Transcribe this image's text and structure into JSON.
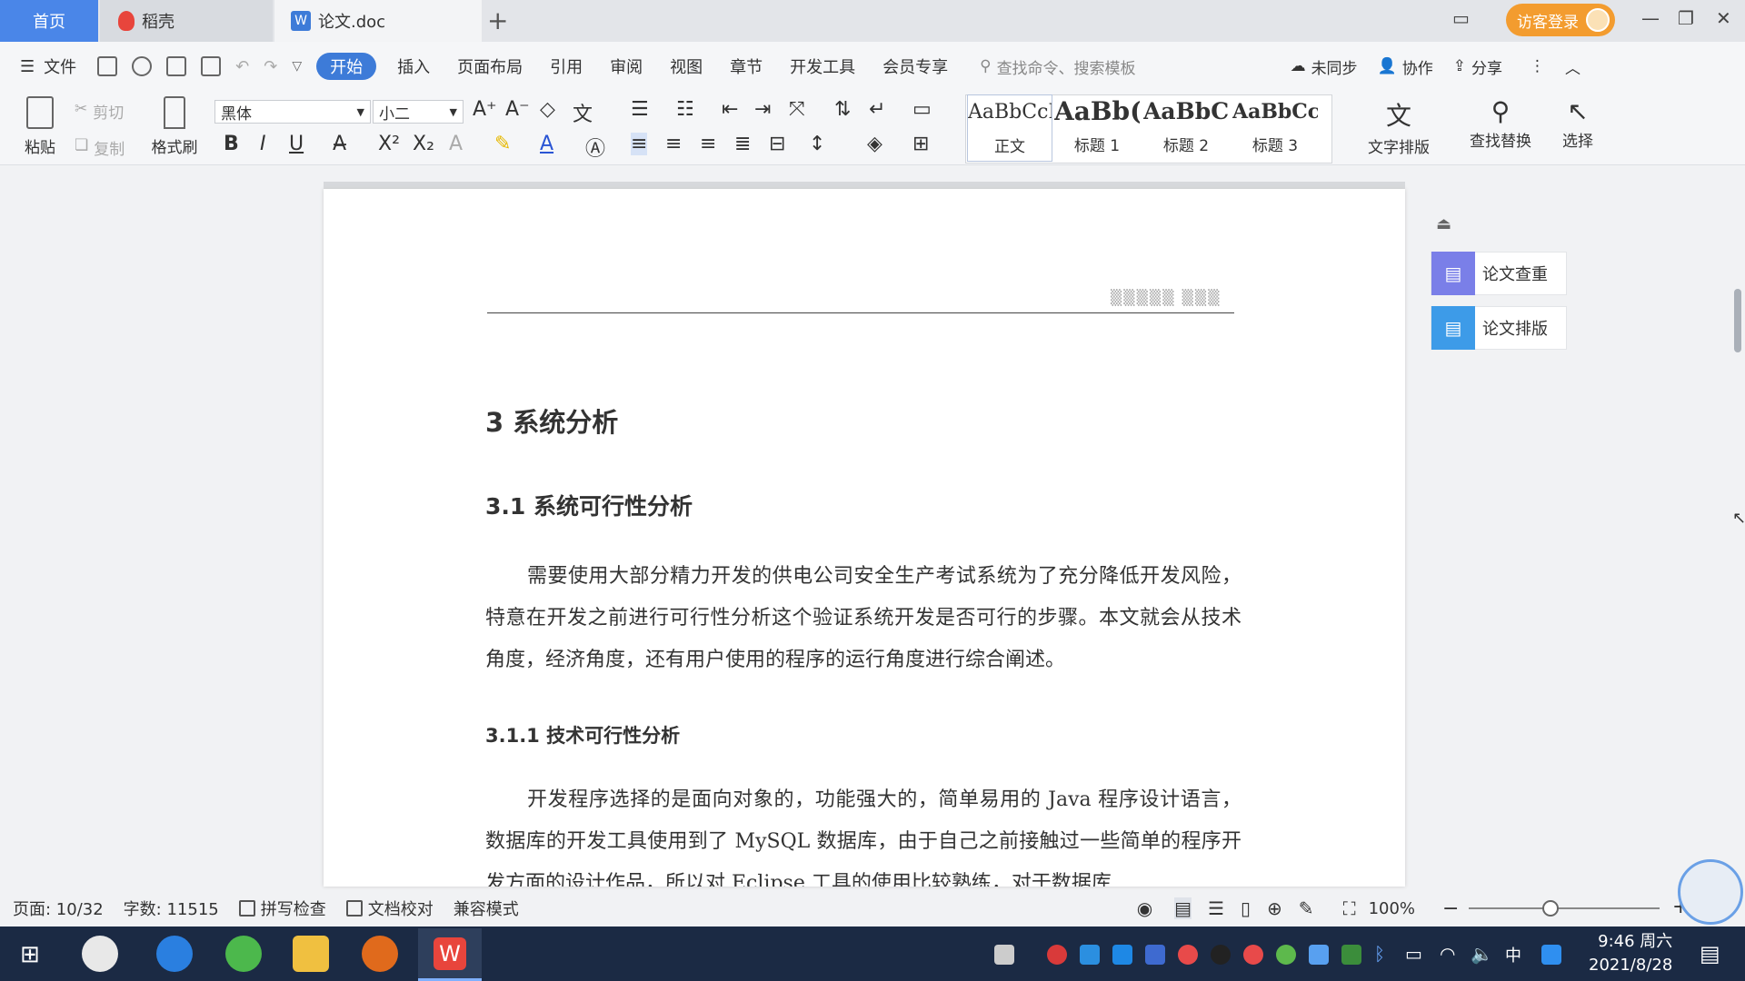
{
  "tabs": {
    "home": "首页",
    "daoke": "稻壳",
    "doc": "论文.doc",
    "new": "+"
  },
  "titlebar": {
    "login": "访客登录"
  },
  "menu": {
    "file": "文件",
    "items": [
      "开始",
      "插入",
      "页面布局",
      "引用",
      "审阅",
      "视图",
      "章节",
      "开发工具",
      "会员专享"
    ],
    "active": "开始",
    "search_placeholder": "查找命令、搜索模板",
    "sync": "未同步",
    "collab": "协作",
    "share": "分享"
  },
  "ribbon": {
    "paste": "粘贴",
    "cut": "剪切",
    "copy": "复制",
    "format_painter": "格式刷",
    "font": "黑体",
    "size": "小二",
    "styles": [
      {
        "sample": "AaBbCcI",
        "name": "正文"
      },
      {
        "sample": "AaBb(",
        "name": "标题 1"
      },
      {
        "sample": "AaBbC",
        "name": "标题 2"
      },
      {
        "sample": "AaBbCcl",
        "name": "标题 3"
      }
    ],
    "text_layout": "文字排版",
    "find_replace": "查找替换",
    "select": "选择"
  },
  "sidepanel": {
    "check": "论文查重",
    "layout": "论文排版"
  },
  "document": {
    "h1": "3  系统分析",
    "h2": "3.1 系统可行性分析",
    "p1": "需要使用大部分精力开发的供电公司安全生产考试系统为了充分降低开发风险，特意在开发之前进行可行性分析这个验证系统开发是否可行的步骤。本文就会从技术角度，经济角度，还有用户使用的程序的运行角度进行综合阐述。",
    "h3": "3.1.1  技术可行性分析",
    "p2": "开发程序选择的是面向对象的，功能强大的，简单易用的 Java 程序设计语言，数据库的开发工具使用到了 MySQL 数据库，由于自己之前接触过一些简单的程序开发方面的设计作品，所以对 Eclipse 工具的使用比较熟练，对于数据库"
  },
  "status": {
    "page": "页面: 10/32",
    "words": "字数: 11515",
    "spell": "拼写检查",
    "proof": "文档校对",
    "compat": "兼容模式",
    "zoom": "100%",
    "zoom_level": 0.43
  },
  "taskbar": {
    "time": "9:46 周六",
    "date": "2021/8/28",
    "ime": "中"
  },
  "colors": {
    "accent": "#3d7bd8",
    "login": "#f39c2f",
    "wps_red": "#e8453c",
    "taskbar": "#1b2a44"
  }
}
